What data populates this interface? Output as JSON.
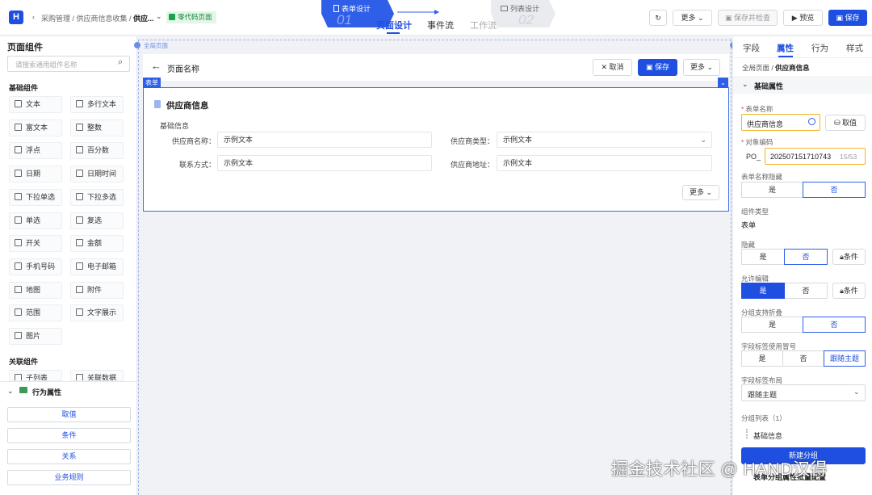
{
  "header": {
    "breadcrumb": "采购管理 / 供应商信息收集 /",
    "current": "供应...",
    "badge": "零代码页面",
    "step1_label": "表单设计",
    "step1_num": "01",
    "step2_label": "列表设计",
    "step2_num": "02",
    "tab_page_design": "页面设计",
    "tab_event_flow": "事件流",
    "tab_work_flow": "工作流",
    "more": "更多",
    "save_check": "保存并检查",
    "preview": "预览",
    "save": "保存"
  },
  "left_panel": {
    "title": "页面组件",
    "search_placeholder": "请搜索通用组件名称",
    "basic_title": "基础组件",
    "components": [
      {
        "label": "文本",
        "icon": "text-icon"
      },
      {
        "label": "多行文本",
        "icon": "multiline-text-icon"
      },
      {
        "label": "富文本",
        "icon": "rich-text-icon"
      },
      {
        "label": "整数",
        "icon": "integer-icon"
      },
      {
        "label": "浮点",
        "icon": "float-icon"
      },
      {
        "label": "百分数",
        "icon": "percent-icon"
      },
      {
        "label": "日期",
        "icon": "date-icon"
      },
      {
        "label": "日期时间",
        "icon": "datetime-icon"
      },
      {
        "label": "下拉单选",
        "icon": "select-single-icon"
      },
      {
        "label": "下拉多选",
        "icon": "select-multi-icon"
      },
      {
        "label": "单选",
        "icon": "radio-icon"
      },
      {
        "label": "复选",
        "icon": "checkbox-icon"
      },
      {
        "label": "开关",
        "icon": "switch-icon"
      },
      {
        "label": "金额",
        "icon": "currency-icon"
      },
      {
        "label": "手机号码",
        "icon": "phone-icon"
      },
      {
        "label": "电子邮箱",
        "icon": "email-icon"
      },
      {
        "label": "地图",
        "icon": "map-icon"
      },
      {
        "label": "附件",
        "icon": "attachment-icon"
      },
      {
        "label": "范围",
        "icon": "range-icon"
      },
      {
        "label": "文字展示",
        "icon": "text-display-icon"
      },
      {
        "label": "图片",
        "icon": "image-icon"
      }
    ],
    "related_title": "关联组件",
    "related": [
      {
        "label": "子列表"
      },
      {
        "label": "关联数据"
      }
    ],
    "behavior_title": "行为属性",
    "behaviors": [
      "取值",
      "条件",
      "关系",
      "业务规则"
    ]
  },
  "canvas": {
    "full_page_label": "全局页面",
    "page_name": "页面名称",
    "cancel": "取消",
    "save": "保存",
    "more": "更多",
    "form_tag": "表单",
    "form_title": "供应商信息",
    "group_title": "基础信息",
    "fields": [
      {
        "label": "供应商名称：",
        "value": "示例文本"
      },
      {
        "label": "供应商类型：",
        "value": "示例文本"
      },
      {
        "label": "联系方式：",
        "value": "示例文本"
      },
      {
        "label": "供应商地址：",
        "value": "示例文本"
      }
    ],
    "form_more": "更多"
  },
  "right_panel": {
    "tabs": [
      "字段",
      "属性",
      "行为",
      "样式"
    ],
    "active_tab": "属性",
    "breadcrumb_root": "全局页面",
    "breadcrumb_sep": "/",
    "breadcrumb_current": "供应商信息",
    "section_title": "基础属性",
    "form_name_label": "表单名称",
    "form_name_value": "供应商信息",
    "get_value": "取值",
    "object_code_label": "对象编码",
    "object_code_prefix": "PO_",
    "object_code_value": "202507151710743",
    "object_code_count": "15/53",
    "hide_form_name_label": "表单名称隐藏",
    "yes": "是",
    "no": "否",
    "comp_type_label": "组件类型",
    "comp_type_value": "表单",
    "hidden_label": "隐藏",
    "condition": "条件",
    "editable_label": "允许编辑",
    "collapse_label": "分组支持折叠",
    "colon_label": "字段标签使用冒号",
    "follow_theme": "跟随主题",
    "layout_label": "字段标签布局",
    "layout_value": "跟随主题",
    "group_list_label": "分组列表（1）",
    "group_item": "基础信息",
    "new_group": "新建分组",
    "form_group_tip": "表单分组属性批量配置"
  },
  "watermark": "掘金技术社区 @ HAND汉得",
  "colors": {
    "accent": "#1f4fe0",
    "success": "#1aa34a",
    "required": "#e34040"
  }
}
